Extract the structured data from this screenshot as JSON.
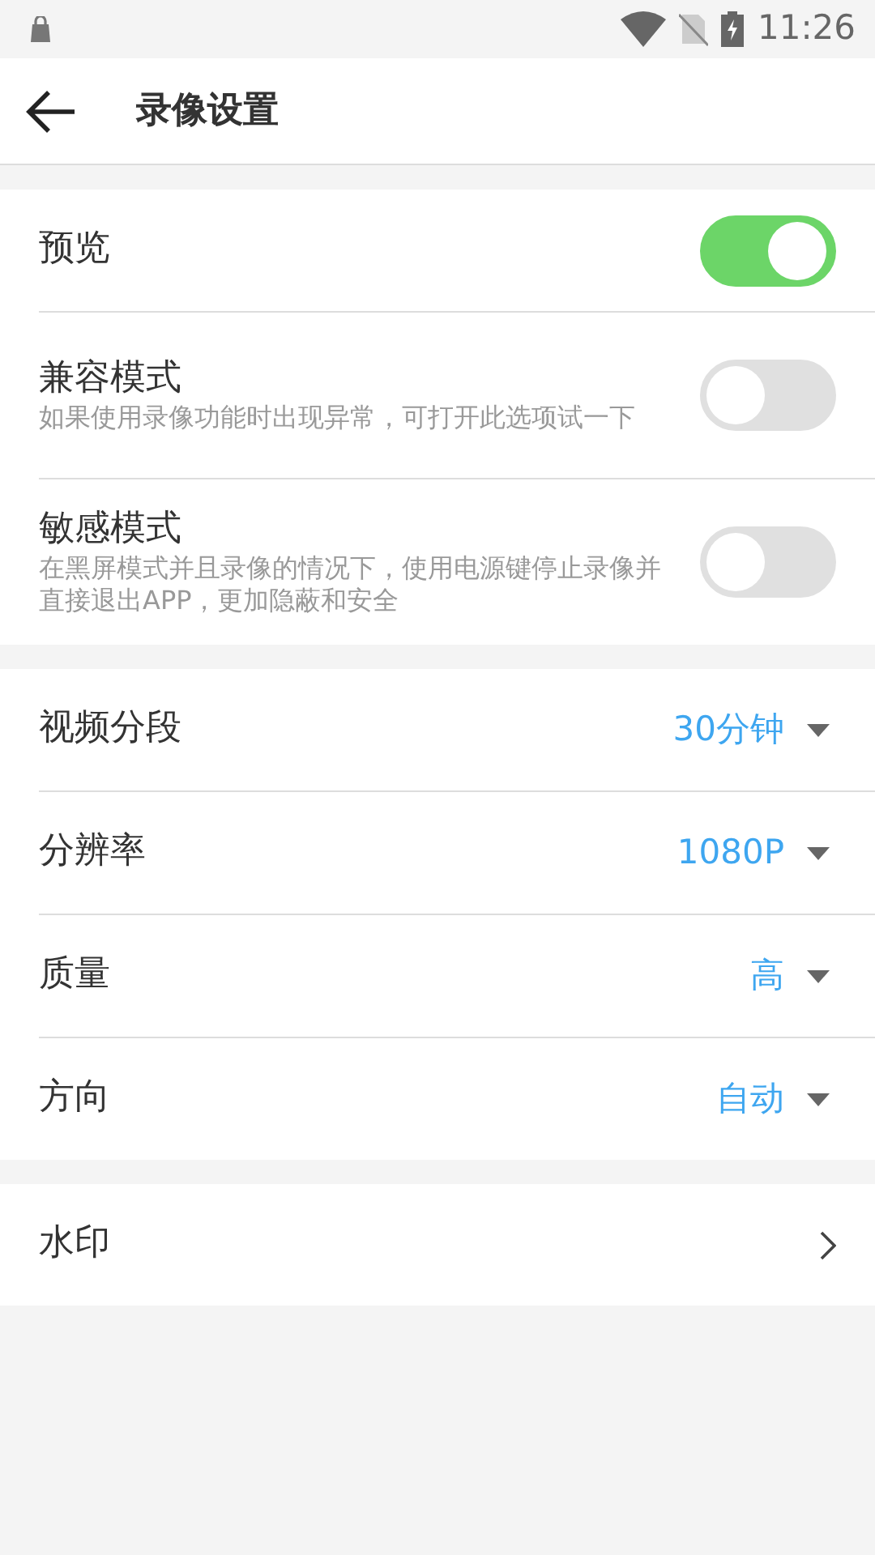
{
  "status_bar": {
    "time": "11:26"
  },
  "header": {
    "title": "录像设置"
  },
  "sections": [
    {
      "items": [
        {
          "kind": "switch",
          "label": "预览",
          "on": true
        },
        {
          "kind": "switch",
          "label": "兼容模式",
          "description": "如果使用录像功能时出现异常，可打开此选项试一下",
          "on": false
        },
        {
          "kind": "switch",
          "label": "敏感模式",
          "description": "在黑屏模式并且录像的情况下，使用电源键停止录像并直接退出APP，更加隐蔽和安全",
          "on": false
        }
      ]
    },
    {
      "items": [
        {
          "kind": "select",
          "label": "视频分段",
          "value": "30分钟"
        },
        {
          "kind": "select",
          "label": "分辨率",
          "value": "1080P"
        },
        {
          "kind": "select",
          "label": "质量",
          "value": "高"
        },
        {
          "kind": "select",
          "label": "方向",
          "value": "自动"
        }
      ]
    },
    {
      "items": [
        {
          "kind": "link",
          "label": "水印"
        }
      ]
    }
  ]
}
